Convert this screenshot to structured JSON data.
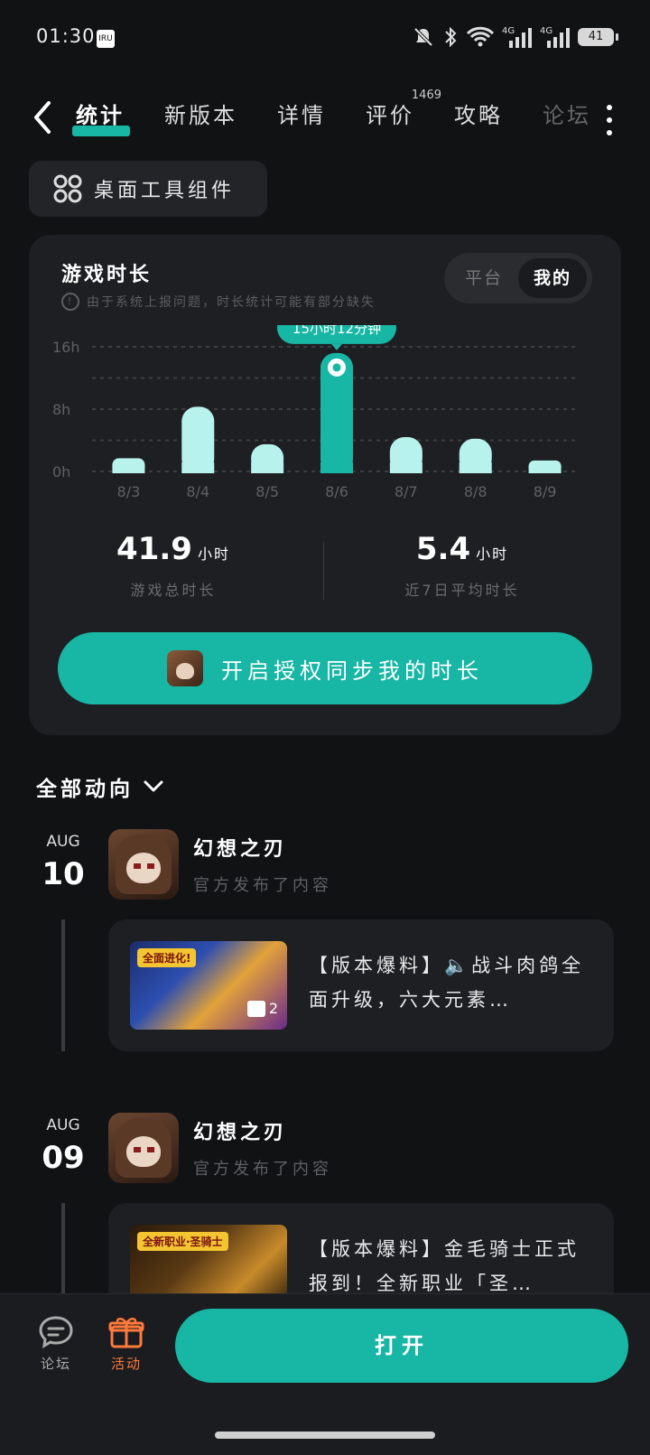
{
  "status_bar": {
    "time": "01:30",
    "small_badge": "IRU",
    "battery": "41",
    "network": [
      "4G",
      "4G"
    ]
  },
  "nav": {
    "tabs": [
      {
        "label": "统计",
        "active": true
      },
      {
        "label": "新版本"
      },
      {
        "label": "详情"
      },
      {
        "label": "评价",
        "badge": "1469"
      },
      {
        "label": "攻略"
      },
      {
        "label": "论坛"
      }
    ]
  },
  "widget_chip": {
    "label": "桌面工具组件",
    "icon": "grid-icon"
  },
  "stats_card": {
    "title": "游戏时长",
    "note": "由于系统上报问题，时长统计可能有部分缺失",
    "segment": {
      "option1": "平台",
      "option2": "我的",
      "selected": "我的"
    },
    "tooltip": "15小时12分钟",
    "total": {
      "value": "41.9",
      "unit": "小时",
      "label": "游戏总时长"
    },
    "average": {
      "value": "5.4",
      "unit": "小时",
      "label": "近7日平均时长"
    },
    "sync_button": "开启授权同步我的时长"
  },
  "chart_data": {
    "type": "bar",
    "categories": [
      "8/3",
      "8/4",
      "8/5",
      "8/6",
      "8/7",
      "8/8",
      "8/9"
    ],
    "values": [
      1.7,
      8.3,
      3.5,
      15.2,
      4.4,
      4.2,
      1.4
    ],
    "ylim": [
      0,
      16
    ],
    "yticks": [
      "0h",
      "8h",
      "16h"
    ],
    "highlight_index": 3,
    "colors": {
      "bar": "#b7f2ec",
      "highlight": "#18b6a4",
      "grid": "#3c3e43"
    },
    "grid": true
  },
  "feed": {
    "header": "全部动向",
    "items": [
      {
        "month": "AUG",
        "day": "10",
        "game": "幻想之刃",
        "action": "官方发布了内容",
        "text": "【版本爆料】🔈战斗肉鸽全面升级，六大元素…",
        "thumb_tag": "全面进化!",
        "image_count": "2"
      },
      {
        "month": "AUG",
        "day": "09",
        "game": "幻想之刃",
        "action": "官方发布了内容",
        "text": "【版本爆料】金毛骑士正式报到！全新职业「圣…",
        "thumb_tag": "全新职业·圣骑士"
      }
    ]
  },
  "bottom_bar": {
    "forum": "论坛",
    "activity": "活动",
    "open": "打开",
    "accent": "#ff7a3d"
  }
}
